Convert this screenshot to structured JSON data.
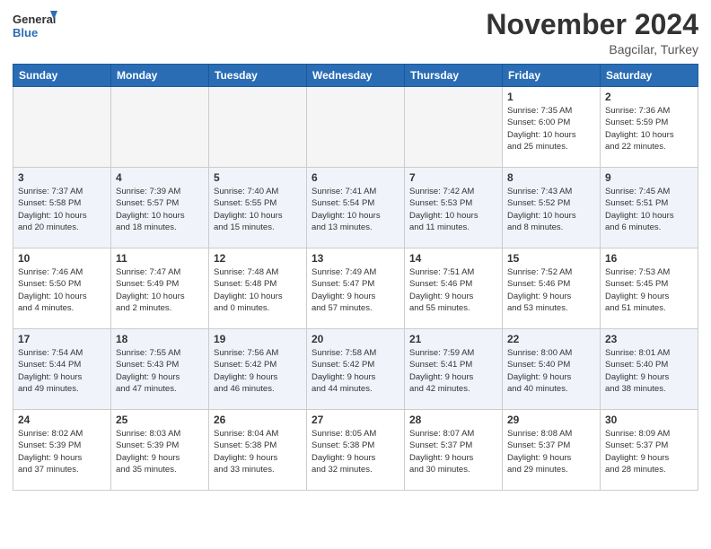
{
  "logo": {
    "line1": "General",
    "line2": "Blue"
  },
  "title": "November 2024",
  "subtitle": "Bagcilar, Turkey",
  "weekdays": [
    "Sunday",
    "Monday",
    "Tuesday",
    "Wednesday",
    "Thursday",
    "Friday",
    "Saturday"
  ],
  "weeks": [
    [
      {
        "day": "",
        "info": ""
      },
      {
        "day": "",
        "info": ""
      },
      {
        "day": "",
        "info": ""
      },
      {
        "day": "",
        "info": ""
      },
      {
        "day": "",
        "info": ""
      },
      {
        "day": "1",
        "info": "Sunrise: 7:35 AM\nSunset: 6:00 PM\nDaylight: 10 hours\nand 25 minutes."
      },
      {
        "day": "2",
        "info": "Sunrise: 7:36 AM\nSunset: 5:59 PM\nDaylight: 10 hours\nand 22 minutes."
      }
    ],
    [
      {
        "day": "3",
        "info": "Sunrise: 7:37 AM\nSunset: 5:58 PM\nDaylight: 10 hours\nand 20 minutes."
      },
      {
        "day": "4",
        "info": "Sunrise: 7:39 AM\nSunset: 5:57 PM\nDaylight: 10 hours\nand 18 minutes."
      },
      {
        "day": "5",
        "info": "Sunrise: 7:40 AM\nSunset: 5:55 PM\nDaylight: 10 hours\nand 15 minutes."
      },
      {
        "day": "6",
        "info": "Sunrise: 7:41 AM\nSunset: 5:54 PM\nDaylight: 10 hours\nand 13 minutes."
      },
      {
        "day": "7",
        "info": "Sunrise: 7:42 AM\nSunset: 5:53 PM\nDaylight: 10 hours\nand 11 minutes."
      },
      {
        "day": "8",
        "info": "Sunrise: 7:43 AM\nSunset: 5:52 PM\nDaylight: 10 hours\nand 8 minutes."
      },
      {
        "day": "9",
        "info": "Sunrise: 7:45 AM\nSunset: 5:51 PM\nDaylight: 10 hours\nand 6 minutes."
      }
    ],
    [
      {
        "day": "10",
        "info": "Sunrise: 7:46 AM\nSunset: 5:50 PM\nDaylight: 10 hours\nand 4 minutes."
      },
      {
        "day": "11",
        "info": "Sunrise: 7:47 AM\nSunset: 5:49 PM\nDaylight: 10 hours\nand 2 minutes."
      },
      {
        "day": "12",
        "info": "Sunrise: 7:48 AM\nSunset: 5:48 PM\nDaylight: 10 hours\nand 0 minutes."
      },
      {
        "day": "13",
        "info": "Sunrise: 7:49 AM\nSunset: 5:47 PM\nDaylight: 9 hours\nand 57 minutes."
      },
      {
        "day": "14",
        "info": "Sunrise: 7:51 AM\nSunset: 5:46 PM\nDaylight: 9 hours\nand 55 minutes."
      },
      {
        "day": "15",
        "info": "Sunrise: 7:52 AM\nSunset: 5:46 PM\nDaylight: 9 hours\nand 53 minutes."
      },
      {
        "day": "16",
        "info": "Sunrise: 7:53 AM\nSunset: 5:45 PM\nDaylight: 9 hours\nand 51 minutes."
      }
    ],
    [
      {
        "day": "17",
        "info": "Sunrise: 7:54 AM\nSunset: 5:44 PM\nDaylight: 9 hours\nand 49 minutes."
      },
      {
        "day": "18",
        "info": "Sunrise: 7:55 AM\nSunset: 5:43 PM\nDaylight: 9 hours\nand 47 minutes."
      },
      {
        "day": "19",
        "info": "Sunrise: 7:56 AM\nSunset: 5:42 PM\nDaylight: 9 hours\nand 46 minutes."
      },
      {
        "day": "20",
        "info": "Sunrise: 7:58 AM\nSunset: 5:42 PM\nDaylight: 9 hours\nand 44 minutes."
      },
      {
        "day": "21",
        "info": "Sunrise: 7:59 AM\nSunset: 5:41 PM\nDaylight: 9 hours\nand 42 minutes."
      },
      {
        "day": "22",
        "info": "Sunrise: 8:00 AM\nSunset: 5:40 PM\nDaylight: 9 hours\nand 40 minutes."
      },
      {
        "day": "23",
        "info": "Sunrise: 8:01 AM\nSunset: 5:40 PM\nDaylight: 9 hours\nand 38 minutes."
      }
    ],
    [
      {
        "day": "24",
        "info": "Sunrise: 8:02 AM\nSunset: 5:39 PM\nDaylight: 9 hours\nand 37 minutes."
      },
      {
        "day": "25",
        "info": "Sunrise: 8:03 AM\nSunset: 5:39 PM\nDaylight: 9 hours\nand 35 minutes."
      },
      {
        "day": "26",
        "info": "Sunrise: 8:04 AM\nSunset: 5:38 PM\nDaylight: 9 hours\nand 33 minutes."
      },
      {
        "day": "27",
        "info": "Sunrise: 8:05 AM\nSunset: 5:38 PM\nDaylight: 9 hours\nand 32 minutes."
      },
      {
        "day": "28",
        "info": "Sunrise: 8:07 AM\nSunset: 5:37 PM\nDaylight: 9 hours\nand 30 minutes."
      },
      {
        "day": "29",
        "info": "Sunrise: 8:08 AM\nSunset: 5:37 PM\nDaylight: 9 hours\nand 29 minutes."
      },
      {
        "day": "30",
        "info": "Sunrise: 8:09 AM\nSunset: 5:37 PM\nDaylight: 9 hours\nand 28 minutes."
      }
    ]
  ]
}
